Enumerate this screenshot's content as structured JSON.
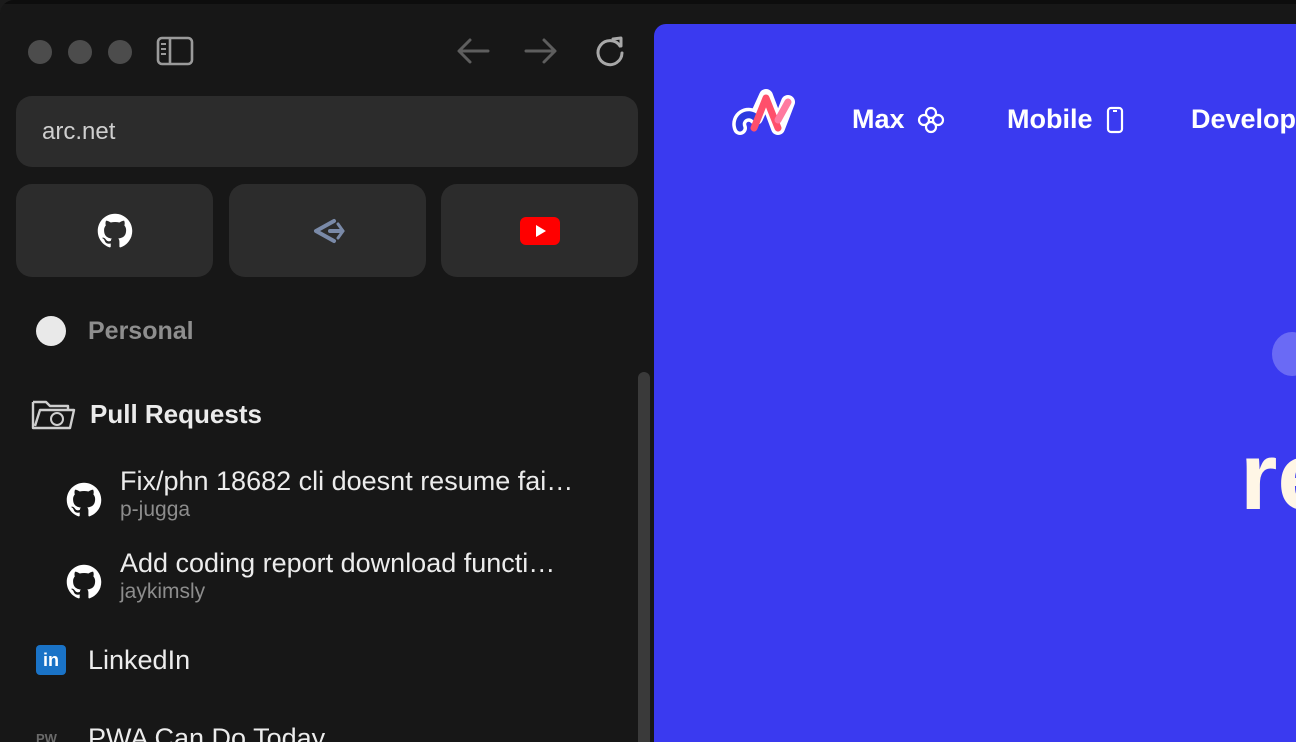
{
  "browser": {
    "url": "arc.net",
    "pinned": [
      {
        "name": "github-pin"
      },
      {
        "name": "linear-pin"
      },
      {
        "name": "youtube-pin"
      }
    ]
  },
  "sidebar": {
    "space": {
      "label": "Personal"
    },
    "folder": {
      "label": "Pull Requests"
    },
    "tabs": [
      {
        "title": "Fix/phn 18682 cli doesnt resume fai…",
        "subtitle": "p-jugga"
      },
      {
        "title": "Add coding report download functi…",
        "subtitle": "jaykimsly"
      }
    ],
    "items": [
      {
        "label": "LinkedIn",
        "icon_text": "in"
      },
      {
        "label": "PWA Can Do Today",
        "icon_text": "PW"
      }
    ]
  },
  "page": {
    "nav": [
      {
        "label": "Max",
        "icon": "flower-icon"
      },
      {
        "label": "Mobile",
        "icon": "phone-icon"
      },
      {
        "label": "Develop"
      }
    ],
    "hero_partial": "re"
  },
  "colors": {
    "page_bg": "#3a3af0",
    "sidebar_bg": "#171717",
    "youtube_red": "#ff0000",
    "linkedin_blue": "#1a73c7"
  }
}
